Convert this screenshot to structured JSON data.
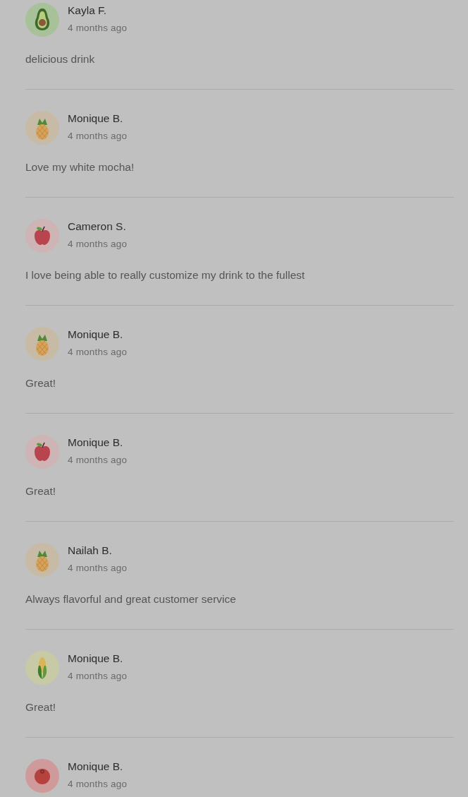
{
  "reviews": [
    {
      "name": "Kayla F.",
      "time": "4 months ago",
      "comment": "delicious drink",
      "avatar": {
        "kind": "avocado"
      }
    },
    {
      "name": "Monique B.",
      "time": "4 months ago",
      "comment": "Love my white mocha!",
      "avatar": {
        "kind": "pineapple"
      }
    },
    {
      "name": "Cameron S.",
      "time": "4 months ago",
      "comment": "I love being able to really customize my drink to the fullest",
      "avatar": {
        "kind": "apple"
      }
    },
    {
      "name": "Monique B.",
      "time": "4 months ago",
      "comment": "Great!",
      "avatar": {
        "kind": "pineapple"
      }
    },
    {
      "name": "Monique B.",
      "time": "4 months ago",
      "comment": "Great!",
      "avatar": {
        "kind": "apple"
      }
    },
    {
      "name": "Nailah B.",
      "time": "4 months ago",
      "comment": "Always flavorful and great customer service",
      "avatar": {
        "kind": "pineapple"
      }
    },
    {
      "name": "Monique B.",
      "time": "4 months ago",
      "comment": "Great!",
      "avatar": {
        "kind": "corn"
      }
    },
    {
      "name": "Monique B.",
      "time": "4 months ago",
      "avatar": {
        "kind": "tomato"
      }
    }
  ]
}
